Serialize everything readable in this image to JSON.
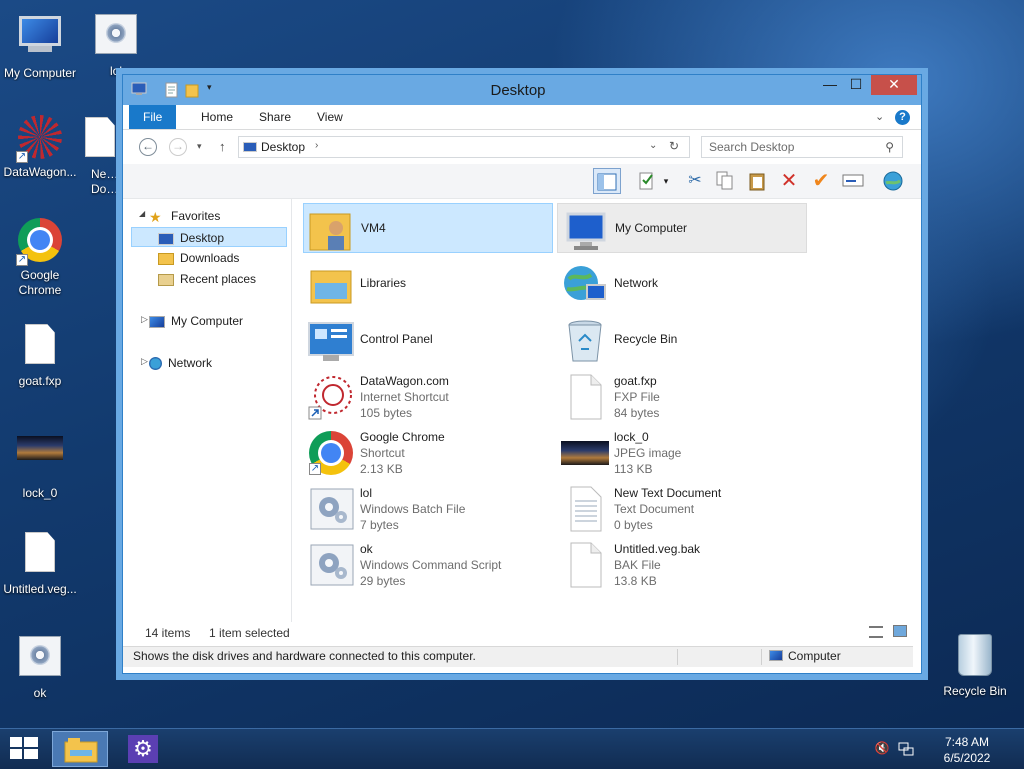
{
  "desktop": {
    "icons": [
      {
        "label": "My Computer"
      },
      {
        "label": "lol"
      },
      {
        "label": "DataWagon..."
      },
      {
        "label": "New T\nDocum"
      },
      {
        "label": "Google\nChrome"
      },
      {
        "label": "goat.fxp"
      },
      {
        "label": "lock_0"
      },
      {
        "label": "Untitled.veg..."
      },
      {
        "label": "ok"
      },
      {
        "label": "Recycle Bin"
      }
    ]
  },
  "window": {
    "title": "Desktop",
    "controls": {
      "minimize": "—",
      "maximize": "☐",
      "close": "✕"
    },
    "ribbon_tabs": [
      "File",
      "Home",
      "Share",
      "View"
    ],
    "address": {
      "location": "Desktop"
    },
    "search": {
      "placeholder": "Search Desktop"
    },
    "nav_pane": {
      "favorites": "Favorites",
      "desktop": "Desktop",
      "downloads": "Downloads",
      "recent": "Recent places",
      "my_computer": "My Computer",
      "network": "Network"
    },
    "items": [
      {
        "name": "VM4",
        "type": "",
        "size": "",
        "icon": "user-folder-icon",
        "state": "selected"
      },
      {
        "name": "My Computer",
        "type": "",
        "size": "",
        "icon": "computer-icon",
        "state": "hover"
      },
      {
        "name": "Libraries",
        "type": "",
        "size": "",
        "icon": "libraries-icon",
        "state": ""
      },
      {
        "name": "Network",
        "type": "",
        "size": "",
        "icon": "network-icon",
        "state": ""
      },
      {
        "name": "Control Panel",
        "type": "",
        "size": "",
        "icon": "control-panel-icon",
        "state": ""
      },
      {
        "name": "Recycle Bin",
        "type": "",
        "size": "",
        "icon": "recycle-bin-icon",
        "state": ""
      },
      {
        "name": "DataWagon.com",
        "type": "Internet Shortcut",
        "size": "105 bytes",
        "icon": "internet-shortcut-icon",
        "state": ""
      },
      {
        "name": "goat.fxp",
        "type": "FXP File",
        "size": "84 bytes",
        "icon": "file-icon",
        "state": ""
      },
      {
        "name": "Google Chrome",
        "type": "Shortcut",
        "size": "2.13 KB",
        "icon": "chrome-icon",
        "state": ""
      },
      {
        "name": "lock_0",
        "type": "JPEG image",
        "size": "113 KB",
        "icon": "image-icon",
        "state": ""
      },
      {
        "name": "lol",
        "type": "Windows Batch File",
        "size": "7 bytes",
        "icon": "batch-file-icon",
        "state": ""
      },
      {
        "name": "New Text Document",
        "type": "Text Document",
        "size": "0 bytes",
        "icon": "text-doc-icon",
        "state": ""
      },
      {
        "name": "ok",
        "type": "Windows Command Script",
        "size": "29 bytes",
        "icon": "batch-file-icon",
        "state": ""
      },
      {
        "name": "Untitled.veg.bak",
        "type": "BAK File",
        "size": "13.8 KB",
        "icon": "file-icon",
        "state": ""
      }
    ],
    "status": {
      "count": "14 items",
      "selected": "1 item selected"
    },
    "info": {
      "description": "Shows the disk drives and hardware connected to this computer.",
      "location": "Computer"
    }
  },
  "taskbar": {
    "time": "7:48 AM",
    "date": "6/5/2022"
  },
  "colors": {
    "accent": "#1979ca",
    "title_bar": "#69a9e3",
    "selection": "#cce8ff"
  }
}
